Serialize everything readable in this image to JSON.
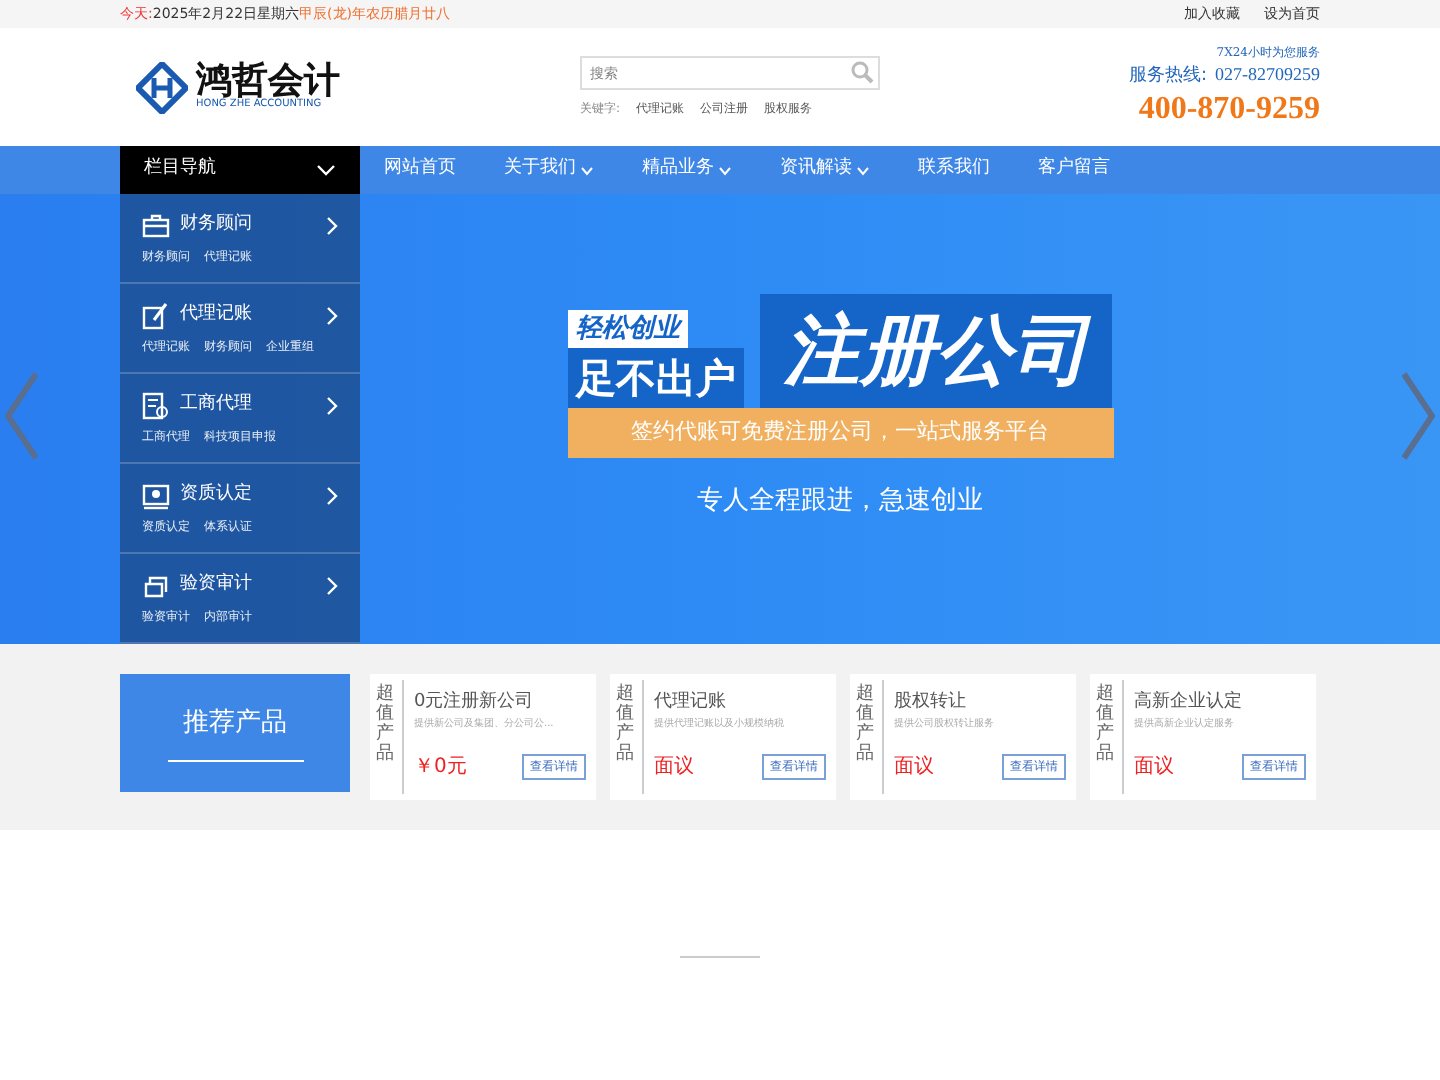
{
  "top_bar": {
    "date_label": "今天:",
    "date": "2025年2月22日星期六",
    "lunar": "甲辰(龙)年农历腊月廿八",
    "links": [
      "加入收藏",
      "设为首页"
    ]
  },
  "header": {
    "logo_name": "鸿哲会计",
    "logo_sub": "HONG ZHE ACCOUNTING",
    "search": {
      "placeholder": "搜索"
    },
    "keywords_label": "关键字:",
    "keywords": [
      "代理记账",
      "公司注册",
      "股权服务"
    ],
    "service_note": "7X24小时为您服务",
    "hotline_label": "服务热线:",
    "hotline": "027-82709259",
    "phone": "400-870-9259"
  },
  "nav": {
    "column_title": "栏目导航",
    "items": [
      {
        "label": "网站首页",
        "dropdown": false
      },
      {
        "label": "关于我们",
        "dropdown": true
      },
      {
        "label": "精品业务",
        "dropdown": true
      },
      {
        "label": "资讯解读",
        "dropdown": true
      },
      {
        "label": "联系我们",
        "dropdown": false
      },
      {
        "label": "客户留言",
        "dropdown": false
      }
    ]
  },
  "sidebar": [
    {
      "kind": "briefcase",
      "title": "财务顾问",
      "links": [
        "财务顾问",
        "代理记账"
      ]
    },
    {
      "kind": "edit",
      "title": "代理记账",
      "links": [
        "代理记账",
        "财务顾问",
        "企业重组"
      ]
    },
    {
      "kind": "document",
      "title": "工商代理",
      "links": [
        "工商代理",
        "科技项目申报"
      ]
    },
    {
      "kind": "certificate",
      "title": "资质认定",
      "links": [
        "资质认定",
        "体系认证"
      ]
    },
    {
      "kind": "audit",
      "title": "验资审计",
      "links": [
        "验资审计",
        "内部审计"
      ]
    }
  ],
  "banner": {
    "tag_small": "轻松创业",
    "tag_big": "足不出户",
    "headline": "注册公司",
    "ribbon": "签约代账可免费注册公司，一站式服务平台",
    "subline": "专人全程跟进，急速创业"
  },
  "recommend": {
    "title": "推荐产品",
    "products": [
      {
        "tag": "超值产品",
        "name": "0元注册新公司",
        "desc": "提供新公司及集团、分公司公...",
        "price": "￥0元",
        "button": "查看详情"
      },
      {
        "tag": "超值产品",
        "name": "代理记账",
        "desc": "提供代理记账以及小规模纳税",
        "price": "面议",
        "button": "查看详情"
      },
      {
        "tag": "超值产品",
        "name": "股权转让",
        "desc": "提供公司股权转让服务",
        "price": "面议",
        "button": "查看详情"
      },
      {
        "tag": "超值产品",
        "name": "高新企业认定",
        "desc": "提供高新企业认定服务",
        "price": "面议",
        "button": "查看详情"
      }
    ]
  }
}
